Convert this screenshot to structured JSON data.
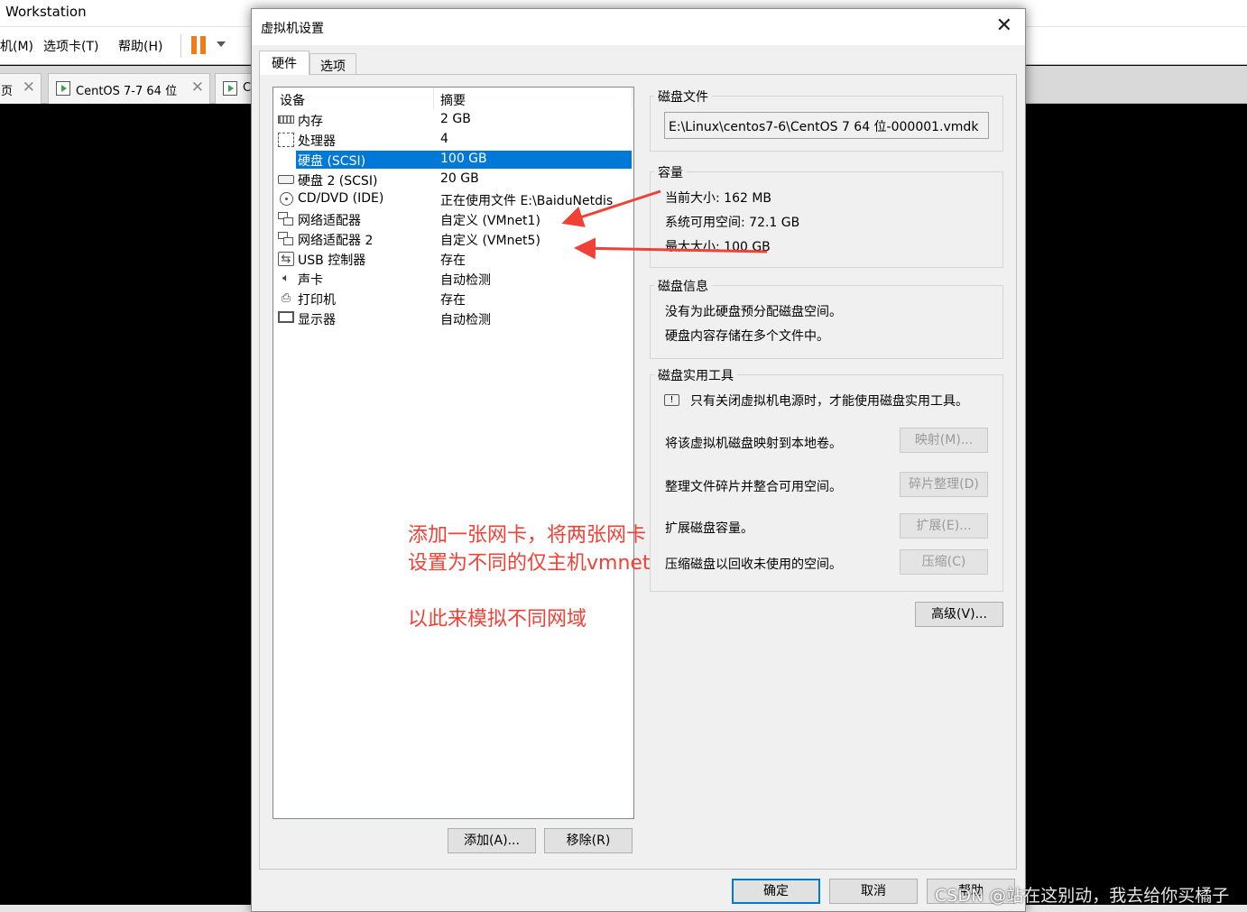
{
  "app": {
    "title": "Workstation",
    "menu": [
      "机(M)",
      "选项卡(T)",
      "帮助(H)"
    ],
    "tabs": [
      {
        "label": "页"
      },
      {
        "label": "CentOS 7-7  64 位"
      },
      {
        "label": "C"
      }
    ]
  },
  "dialog": {
    "title": "虚拟机设置",
    "close_glyph": "✕",
    "tabs": [
      "硬件",
      "选项"
    ],
    "device_list": {
      "columns": [
        "设备",
        "摘要"
      ],
      "rows": [
        {
          "icon": "memory-icon",
          "name": "内存",
          "summary": "2 GB"
        },
        {
          "icon": "processor-icon",
          "name": "处理器",
          "summary": "4"
        },
        {
          "icon": "hard-disk-icon",
          "name": "硬盘 (SCSI)",
          "summary": "100 GB",
          "selected": true
        },
        {
          "icon": "hard-disk-icon",
          "name": "硬盘 2 (SCSI)",
          "summary": "20 GB"
        },
        {
          "icon": "cd-dvd-icon",
          "name": "CD/DVD (IDE)",
          "summary": "正在使用文件 E:\\BaiduNetdis"
        },
        {
          "icon": "network-adapter-icon",
          "name": "网络适配器",
          "summary": "自定义 (VMnet1)"
        },
        {
          "icon": "network-adapter-icon",
          "name": "网络适配器 2",
          "summary": "自定义 (VMnet5)"
        },
        {
          "icon": "usb-controller-icon",
          "name": "USB 控制器",
          "summary": "存在"
        },
        {
          "icon": "sound-card-icon",
          "name": "声卡",
          "summary": "自动检测"
        },
        {
          "icon": "printer-icon",
          "name": "打印机",
          "summary": "存在"
        },
        {
          "icon": "display-icon",
          "name": "显示器",
          "summary": "自动检测"
        }
      ]
    },
    "add_button": "添加(A)...",
    "remove_button": "移除(R)",
    "disk_file": {
      "title": "磁盘文件",
      "path": "E:\\Linux\\centos7-6\\CentOS 7 64 位-000001.vmdk"
    },
    "capacity": {
      "title": "容量",
      "current_size": "当前大小: 162 MB",
      "available": "系统可用空间: 72.1 GB",
      "max_size": "最大大小: 100 GB"
    },
    "disk_info": {
      "title": "磁盘信息",
      "line1": "没有为此硬盘预分配磁盘空间。",
      "line2": "硬盘内容存储在多个文件中。"
    },
    "disk_utilities": {
      "title": "磁盘实用工具",
      "notice": "只有关闭虚拟机电源时，才能使用磁盘实用工具。",
      "map_text": "将该虚拟机磁盘映射到本地卷。",
      "map_button": "映射(M)...",
      "defrag_text": "整理文件碎片并整合可用空间。",
      "defrag_button": "碎片整理(D)",
      "expand_text": "扩展磁盘容量。",
      "expand_button": "扩展(E)...",
      "compact_text": "压缩磁盘以回收未使用的空间。",
      "compact_button": "压缩(C)"
    },
    "advanced_button": "高级(V)...",
    "ok_button": "确定",
    "cancel_button": "取消",
    "help_button": "帮助"
  },
  "annotation": {
    "line1": "添加一张网卡，将两张网卡",
    "line2": "设置为不同的仅主机vmnet",
    "line3": "以此来模拟不同网域",
    "color": "#ef4136"
  },
  "watermark": "CSDN @站在这别动，我去给你买橘子"
}
